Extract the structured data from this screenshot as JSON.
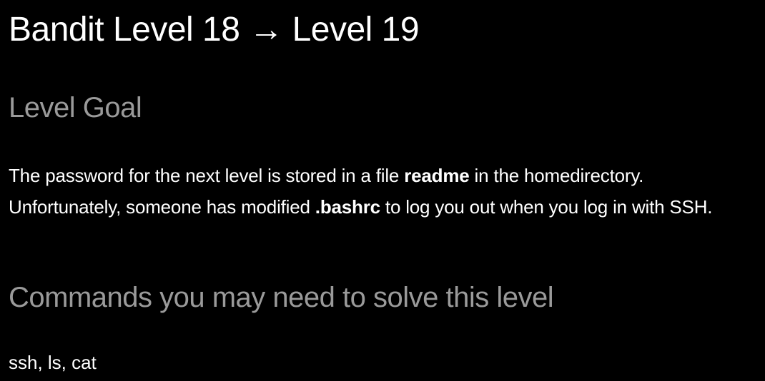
{
  "page": {
    "title": "Bandit Level 18 → Level 19",
    "goal": {
      "heading": "Level Goal",
      "text_1": "The password for the next level is stored in a file ",
      "bold_1": "readme",
      "text_2": " in the homedirectory. Unfortunately, someone has modified ",
      "bold_2": ".bashrc",
      "text_3": " to log you out when you log in with SSH."
    },
    "commands": {
      "heading": "Commands you may need to solve this level",
      "list": "ssh, ls, cat"
    }
  },
  "colors": {
    "background": "#000000",
    "text": "#ffffff",
    "heading": "#9a9a9a"
  }
}
